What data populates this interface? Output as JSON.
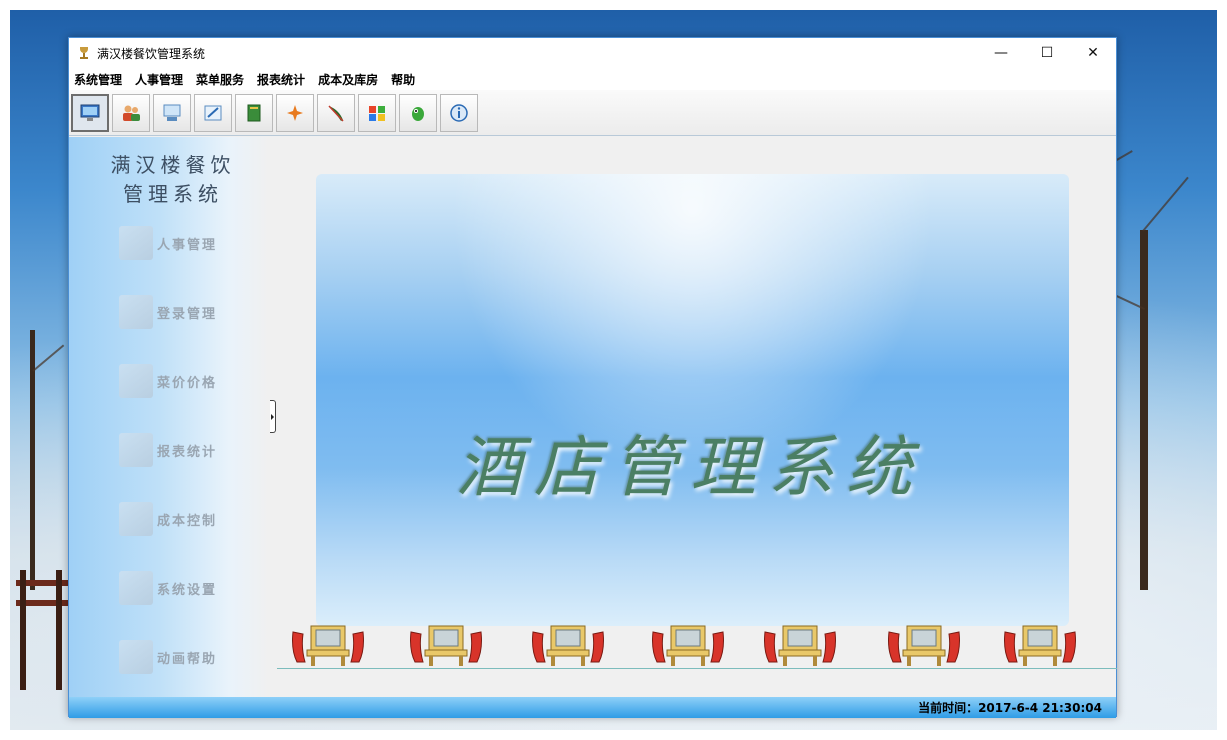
{
  "window": {
    "title": "满汉楼餐饮管理系统",
    "controls": {
      "minimize": "—",
      "maximize": "☐",
      "close": "✕"
    }
  },
  "menu": [
    "系统管理",
    "人事管理",
    "菜单服务",
    "报表统计",
    "成本及库房",
    "帮助"
  ],
  "toolbar": [
    {
      "icon": "computer-icon",
      "active": true
    },
    {
      "icon": "users-icon"
    },
    {
      "icon": "login-icon"
    },
    {
      "icon": "edit-icon"
    },
    {
      "icon": "book-icon"
    },
    {
      "icon": "star-icon"
    },
    {
      "icon": "feather-icon"
    },
    {
      "icon": "windows-icon"
    },
    {
      "icon": "mascot-icon"
    },
    {
      "icon": "info-icon"
    }
  ],
  "sidebar": {
    "title_line1": "满汉楼餐饮",
    "title_line2": "管理系统",
    "items": [
      {
        "label": "人事管理",
        "icon": "personnel-icon"
      },
      {
        "label": "登录管理",
        "icon": "login-icon"
      },
      {
        "label": "菜价价格",
        "icon": "price-icon"
      },
      {
        "label": "报表统计",
        "icon": "report-icon"
      },
      {
        "label": "成本控制",
        "icon": "cost-icon"
      },
      {
        "label": "系统设置",
        "icon": "settings-icon"
      },
      {
        "label": "动画帮助",
        "icon": "help-icon"
      }
    ]
  },
  "banner": {
    "text": "酒店管理系统"
  },
  "status": {
    "time": "当前时间：2017-6-4 21:30:04"
  },
  "colors": {
    "accent": "#2f9ce6",
    "sidebar": "#9fd0f6",
    "banner": "#6cb2ef"
  }
}
